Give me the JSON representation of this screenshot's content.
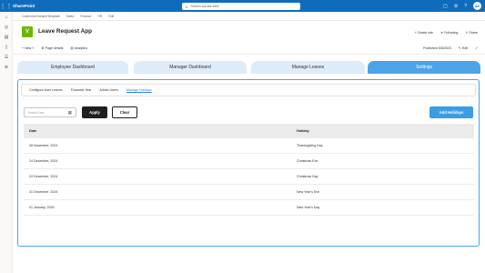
{
  "suite": {
    "app_name": "SharePoint",
    "search_placeholder": "Search across sites",
    "avatar_initials": "AK"
  },
  "hubnav": {
    "items": [
      "CodeminerSampleTemplate",
      "Sales",
      "Finance",
      "HR",
      "Edit"
    ]
  },
  "site": {
    "logo_letter": "V",
    "title": "Leave Request App",
    "actions": {
      "create_site": "Create site",
      "following": "Following",
      "share": "Share"
    }
  },
  "commandbar": {
    "new": "New",
    "page_details": "Page details",
    "analytics": "Analytics",
    "published": "Published 5/8/2023",
    "edit": "Edit"
  },
  "tabs": [
    "Employee Dashboard",
    "Manager Dashboard",
    "Manage Leaves",
    "Settings"
  ],
  "active_tab": "Settings",
  "subtabs": [
    "Configure User Leaves",
    "Financial Year",
    "Admin Users",
    "Manage Holidays"
  ],
  "active_subtab": "Manage Holidays",
  "filter": {
    "date_placeholder": "Select Date",
    "apply_label": "Apply",
    "clear_label": "Clear",
    "add_label": "Add Holidays"
  },
  "table": {
    "columns": [
      "Date",
      "Holiday"
    ],
    "rows": [
      {
        "date": "28 November, 2024",
        "holiday": "Thanksgiving Day"
      },
      {
        "date": "24 December, 2024",
        "holiday": "Christmas Eve"
      },
      {
        "date": "24 December, 2024",
        "holiday": "Christmas Day"
      },
      {
        "date": "31 December, 2024",
        "holiday": "New Year's Eve"
      },
      {
        "date": "01 January, 2025",
        "holiday": "New Year's Day"
      }
    ]
  },
  "colors": {
    "suite_blue": "#0f6cbd",
    "tab_active": "#4da3e8",
    "tab_inactive": "#deecf9",
    "logo_green": "#6bb700",
    "add_button": "#3a9de6"
  }
}
